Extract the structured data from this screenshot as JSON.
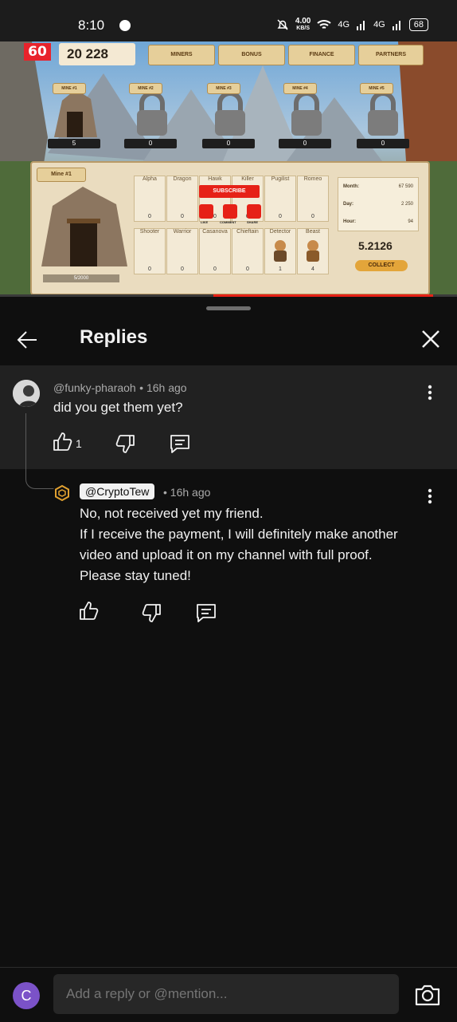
{
  "status_bar": {
    "time": "8:10",
    "net_speed": "4.00",
    "net_unit": "KB/S",
    "signal1": "4G",
    "signal2": "4G",
    "battery": "68"
  },
  "video": {
    "badge": "60",
    "coins": "20 228",
    "nav": [
      "MINERS",
      "BONUS",
      "FINANCE",
      "PARTNERS"
    ],
    "mines": [
      {
        "label": "MINE #1",
        "count": "5"
      },
      {
        "label": "MINE #2",
        "count": "0"
      },
      {
        "label": "MINE #3",
        "count": "0"
      },
      {
        "label": "MINE #4",
        "count": "0"
      },
      {
        "label": "MINE #5",
        "count": "0"
      }
    ],
    "panel_title": "Mine #1",
    "panel_capacity": "5/2000",
    "slots_row1": [
      {
        "name": "Alpha",
        "count": "0"
      },
      {
        "name": "Dragon",
        "count": "0"
      },
      {
        "name": "Hawk",
        "count": "0"
      },
      {
        "name": "Killer",
        "count": "0"
      },
      {
        "name": "Pugilist",
        "count": "0"
      },
      {
        "name": "Romeo",
        "count": "0"
      }
    ],
    "slots_row2": [
      {
        "name": "Shooter",
        "count": "0"
      },
      {
        "name": "Warrior",
        "count": "0"
      },
      {
        "name": "Casanova",
        "count": "0"
      },
      {
        "name": "Chieftain",
        "count": "0"
      },
      {
        "name": "Detector",
        "count": "1"
      },
      {
        "name": "Beast",
        "count": "4"
      }
    ],
    "subscribe_label": "SUBSCRIBE",
    "like_label": "LIKE",
    "comment_label": "COMMENT",
    "share_label": "SHARE",
    "stats": [
      {
        "label": "Month:",
        "value": "67 590"
      },
      {
        "label": "Day:",
        "value": "2 250"
      },
      {
        "label": "Hour:",
        "value": "94"
      }
    ],
    "balance": "5.2126",
    "collect_label": "COLLECT"
  },
  "header": {
    "title": "Replies"
  },
  "parent_comment": {
    "handle": "@funky-pharaoh",
    "time": "• 16h ago",
    "text": "did you get them yet?",
    "likes": "1"
  },
  "reply": {
    "handle": "@CryptoTew",
    "time": "• 16h ago",
    "lines": [
      "No, not received yet my friend.",
      "If I receive the payment, I will definitely make another",
      "video and upload it on my channel with full proof.",
      "Please stay tuned!"
    ]
  },
  "composer": {
    "avatar_letter": "C",
    "placeholder": "Add a reply or @mention..."
  },
  "colors": {
    "accent_red": "#e62117",
    "avatar_purple": "#7b52c8",
    "background": "#0f0f0f"
  }
}
